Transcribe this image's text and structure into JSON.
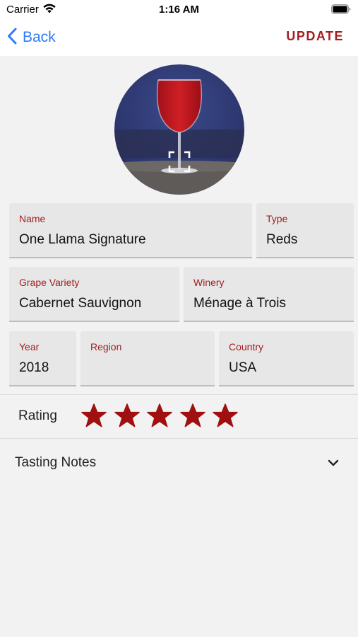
{
  "status": {
    "carrier": "Carrier",
    "time": "1:16 AM"
  },
  "nav": {
    "back_label": "Back",
    "update_label": "UPDATE"
  },
  "icons": {
    "back": "chevron-left-icon",
    "wifi": "wifi-icon",
    "battery": "battery-icon",
    "photo_edit": "viewfinder-icon",
    "star": "star-icon",
    "expand": "chevron-down-icon"
  },
  "colors": {
    "accent": "#a31d21",
    "link": "#2f7cf6",
    "star": "#a01010",
    "field_bg": "#e7e7e7"
  },
  "fields": {
    "name": {
      "label": "Name",
      "value": "One Llama Signature"
    },
    "type": {
      "label": "Type",
      "value": "Reds"
    },
    "grape": {
      "label": "Grape Variety",
      "value": "Cabernet Sauvignon"
    },
    "winery": {
      "label": "Winery",
      "value": "Ménage à Trois"
    },
    "year": {
      "label": "Year",
      "value": "2018"
    },
    "region": {
      "label": "Region",
      "value": ""
    },
    "country": {
      "label": "Country",
      "value": "USA"
    }
  },
  "rating": {
    "label": "Rating",
    "value": 5,
    "max": 5
  },
  "tasting_notes": {
    "label": "Tasting Notes",
    "expanded": false
  }
}
